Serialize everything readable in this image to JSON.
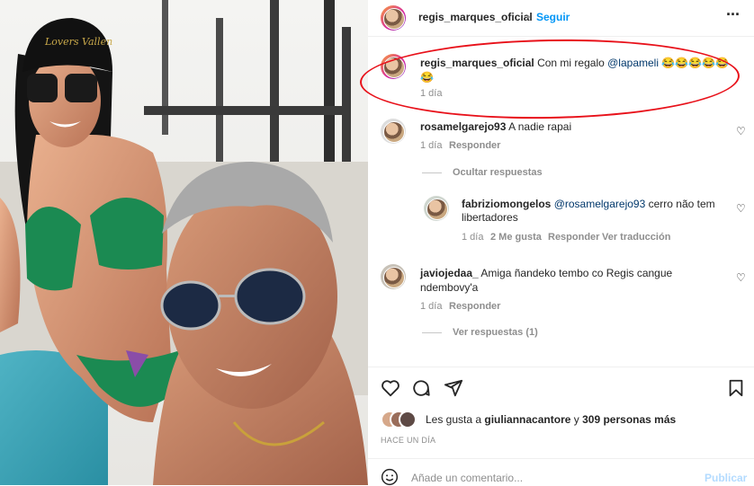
{
  "post": {
    "author": "regis_marques_oficial",
    "follow_label": "Seguir",
    "more_icon": "more-horizontal-icon",
    "photo_cap_text": "Lovers Vallen"
  },
  "caption": {
    "user": "regis_marques_oficial",
    "text": "Con mi regalo",
    "mention": "@lapameli",
    "emojis": "😂😂😂😂😂",
    "emojis2": "😂",
    "time": "1 día"
  },
  "comments": [
    {
      "user": "rosamelgarejo93",
      "text": "A nadie rapai",
      "time": "1 día",
      "reply": "Responder"
    },
    {
      "user": "fabriziomongelos",
      "mention": "@rosamelgarejo93",
      "text": "cerro não tem",
      "text2": "libertadores",
      "time": "1 día",
      "likes": "2 Me gusta",
      "reply": "Responder",
      "translate": "Ver traducción"
    },
    {
      "user": "javiojedaa_",
      "text": "Amiga ñandeko tembo co Regis cangue",
      "text2": "ndembovy'a",
      "time": "1 día",
      "reply": "Responder"
    }
  ],
  "hide_replies": "Ocultar respuestas",
  "view_replies": "Ver respuestas (1)",
  "likes": {
    "prefix": "Les gusta a",
    "user": "giuliannacantore",
    "conj": "y",
    "count": "309 personas más"
  },
  "timestamp": "HACE UN DÍA",
  "add_comment": {
    "placeholder": "Añade un comentario...",
    "publish": "Publicar"
  },
  "colors": {
    "accent": "#0095f6",
    "annotation": "#e8111a"
  }
}
